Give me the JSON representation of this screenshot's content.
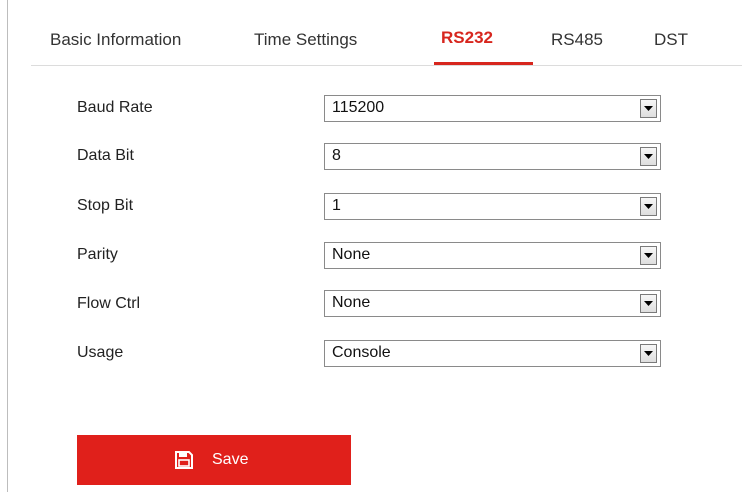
{
  "tabs": [
    {
      "label": "Basic Information",
      "active": false
    },
    {
      "label": "Time Settings",
      "active": false
    },
    {
      "label": "RS232",
      "active": true
    },
    {
      "label": "RS485",
      "active": false
    },
    {
      "label": "DST",
      "active": false
    }
  ],
  "form": {
    "fields": [
      {
        "label": "Baud Rate",
        "value": "115200"
      },
      {
        "label": "Data Bit",
        "value": "8"
      },
      {
        "label": "Stop Bit",
        "value": "1"
      },
      {
        "label": "Parity",
        "value": "None"
      },
      {
        "label": "Flow Ctrl",
        "value": "None"
      },
      {
        "label": "Usage",
        "value": "Console"
      }
    ]
  },
  "save_button": {
    "label": "Save",
    "icon": "save-icon"
  },
  "colors": {
    "accent": "#d7261e",
    "button_bg": "#e0201b"
  }
}
